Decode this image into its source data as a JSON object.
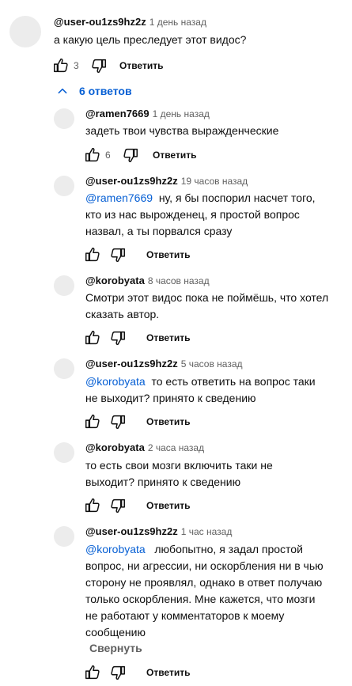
{
  "main": {
    "author": "@user-ou1zs9hz2z",
    "time": "1 день назад",
    "text": "а какую цель преследует этот видос?",
    "likes": "3",
    "reply_label": "Ответить"
  },
  "replies_toggle": {
    "label": "6 ответов"
  },
  "replies": [
    {
      "author": "@ramen7669",
      "time": "1 день назад",
      "text": "задеть твои чувства выражденческие",
      "likes": "6",
      "reply_label": "Ответить"
    },
    {
      "author": "@user-ou1zs9hz2z",
      "time": "19 часов назад",
      "mention": "@ramen7669",
      "text": "ну, я бы поспорил насчет того, кто из нас вырожденец, я простой вопрос назвал, а ты порвался сразу",
      "reply_label": "Ответить"
    },
    {
      "author": "@korobyata",
      "time": "8 часов назад",
      "text": "Смотри этот видос пока не поймёшь, что хотел сказать автор.",
      "reply_label": "Ответить"
    },
    {
      "author": "@user-ou1zs9hz2z",
      "time": "5 часов назад",
      "mention": "@korobyata",
      "text": "то есть ответить на вопрос таки не выходит? принято к сведению",
      "reply_label": "Ответить"
    },
    {
      "author": "@korobyata",
      "time": "2 часа назад",
      "text": "то есть свои мозги включить таки не выходит? принято к сведению",
      "reply_label": "Ответить"
    },
    {
      "author": "@user-ou1zs9hz2z",
      "time": "1 час назад",
      "mention": "@korobyata",
      "text": "любопытно, я задал простой вопрос, ни агрессии, ни оскорбления ни в чью сторону не проявлял, однако в ответ получаю только оскорбления. Мне кажется, что мозги не работают у комментаторов к моему сообщению",
      "collapse_label": "Свернуть",
      "reply_label": "Ответить"
    }
  ],
  "icons": {
    "like": "thumbs-up-icon",
    "dislike": "thumbs-down-icon",
    "toggle": "chevron-up-icon"
  },
  "colors": {
    "link": "#065fd4",
    "meta": "#606060",
    "text": "#0f0f0f",
    "avatar": "#ececec"
  }
}
